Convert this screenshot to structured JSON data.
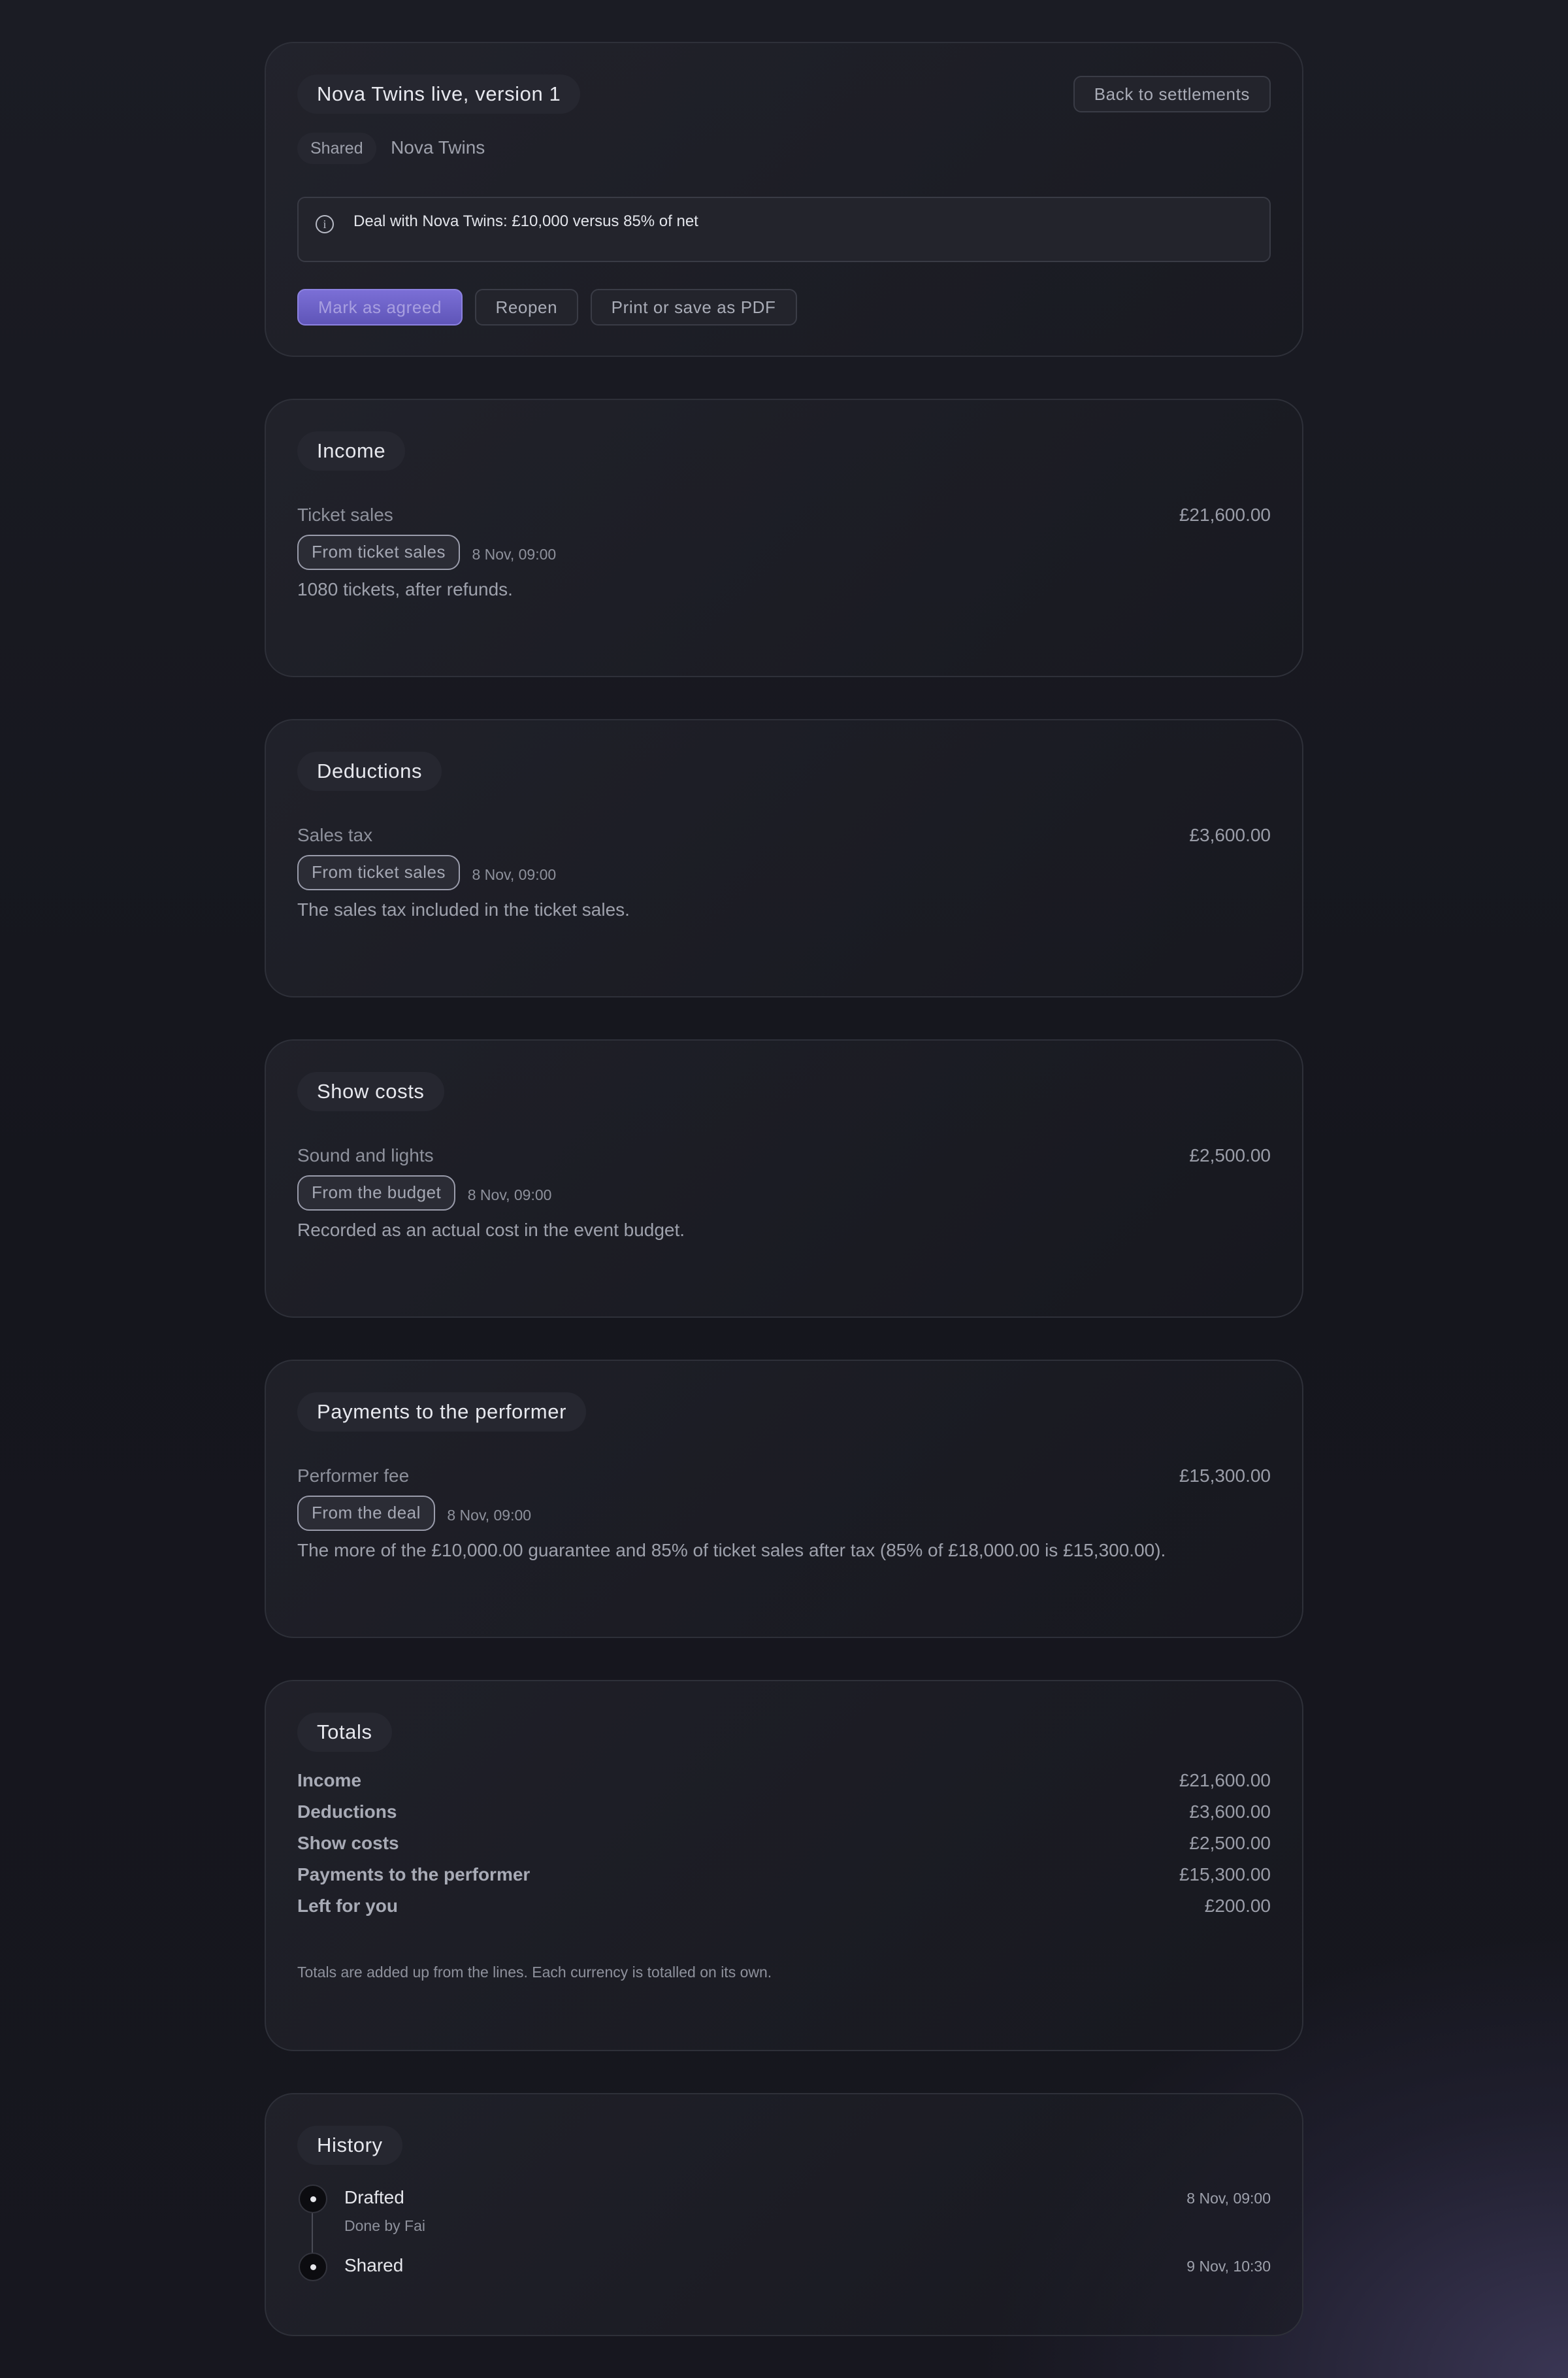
{
  "header": {
    "title": "Nova Twins live, version 1",
    "back_label": "Back to settlements",
    "status": "Shared",
    "performer": "Nova Twins",
    "info_icon": "info-icon",
    "deal_text": "Deal with Nova Twins: £10,000 versus 85% of net",
    "actions": {
      "mark_agreed": "Mark as agreed",
      "reopen": "Reopen",
      "print": "Print or save as PDF"
    },
    "accent_color": "#6b5fc8"
  },
  "sections": [
    {
      "title": "Income",
      "line": {
        "label": "Ticket sales",
        "amount": "£21,600.00",
        "source": "From ticket sales",
        "time": "8 Nov, 09:00",
        "note": "1080 tickets, after refunds."
      }
    },
    {
      "title": "Deductions",
      "line": {
        "label": "Sales tax",
        "amount": "£3,600.00",
        "source": "From ticket sales",
        "time": "8 Nov, 09:00",
        "note": "The sales tax included in the ticket sales."
      }
    },
    {
      "title": "Show costs",
      "line": {
        "label": "Sound and lights",
        "amount": "£2,500.00",
        "source": "From the budget",
        "time": "8 Nov, 09:00",
        "note": "Recorded as an actual cost in the event budget."
      }
    },
    {
      "title": "Payments to the performer",
      "line": {
        "label": "Performer fee",
        "amount": "£15,300.00",
        "source": "From the deal",
        "time": "8 Nov, 09:00",
        "note": "The more of the £10,000.00 guarantee and 85% of ticket sales after tax (85% of £18,000.00 is £15,300.00)."
      }
    }
  ],
  "totals": {
    "title": "Totals",
    "rows": [
      {
        "label": "Income",
        "value": "£21,600.00"
      },
      {
        "label": "Deductions",
        "value": "£3,600.00"
      },
      {
        "label": "Show costs",
        "value": "£2,500.00"
      },
      {
        "label": "Payments to the performer",
        "value": "£15,300.00"
      },
      {
        "label": "Left for you",
        "value": "£200.00"
      }
    ],
    "footnote": "Totals are added up from the lines. Each currency is totalled on its own."
  },
  "history": {
    "title": "History",
    "events": [
      {
        "label": "Drafted",
        "by": "Done by Fai",
        "time": "8 Nov, 09:00"
      },
      {
        "label": "Shared",
        "by": "",
        "time": "9 Nov, 10:30"
      }
    ]
  }
}
